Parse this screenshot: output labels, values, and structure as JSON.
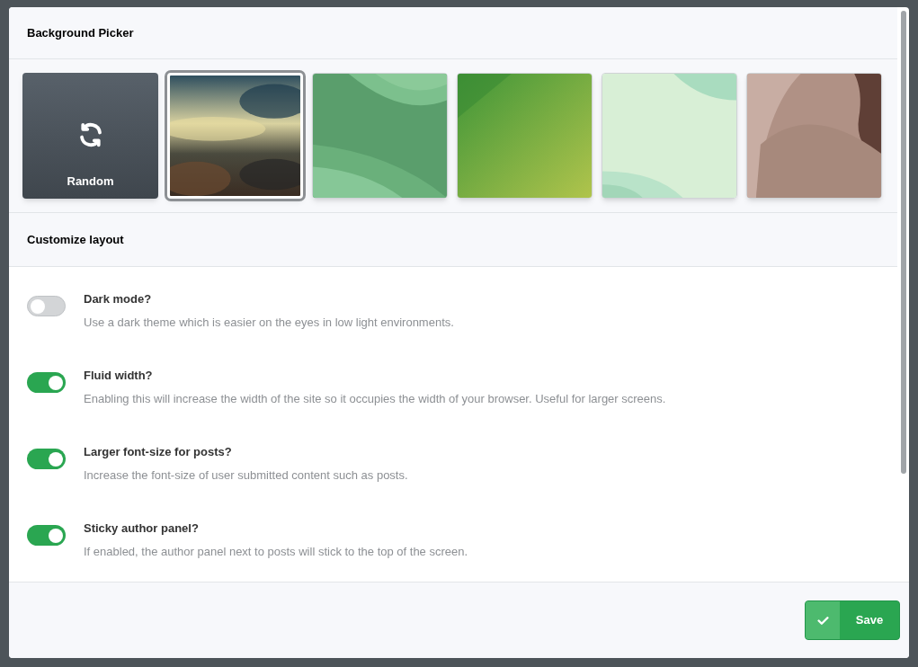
{
  "background_picker": {
    "title": "Background Picker",
    "options": [
      {
        "kind": "random",
        "label": "Random",
        "selected": false
      },
      {
        "kind": "picture",
        "selected": true
      },
      {
        "kind": "picture",
        "selected": false
      },
      {
        "kind": "picture",
        "selected": false
      },
      {
        "kind": "picture",
        "selected": false
      },
      {
        "kind": "picture",
        "selected": false
      }
    ]
  },
  "customize_layout": {
    "title": "Customize layout",
    "settings": [
      {
        "label": "Dark mode?",
        "description": "Use a dark theme which is easier on the eyes in low light environments.",
        "on": false
      },
      {
        "label": "Fluid width?",
        "description": "Enabling this will increase the width of the site so it occupies the width of your browser. Useful for larger screens.",
        "on": true
      },
      {
        "label": "Larger font-size for posts?",
        "description": "Increase the font-size of user submitted content such as posts.",
        "on": true
      },
      {
        "label": "Sticky author panel?",
        "description": "If enabled, the author panel next to posts will stick to the top of the screen.",
        "on": true
      }
    ]
  },
  "footer": {
    "save_button": "Save"
  }
}
